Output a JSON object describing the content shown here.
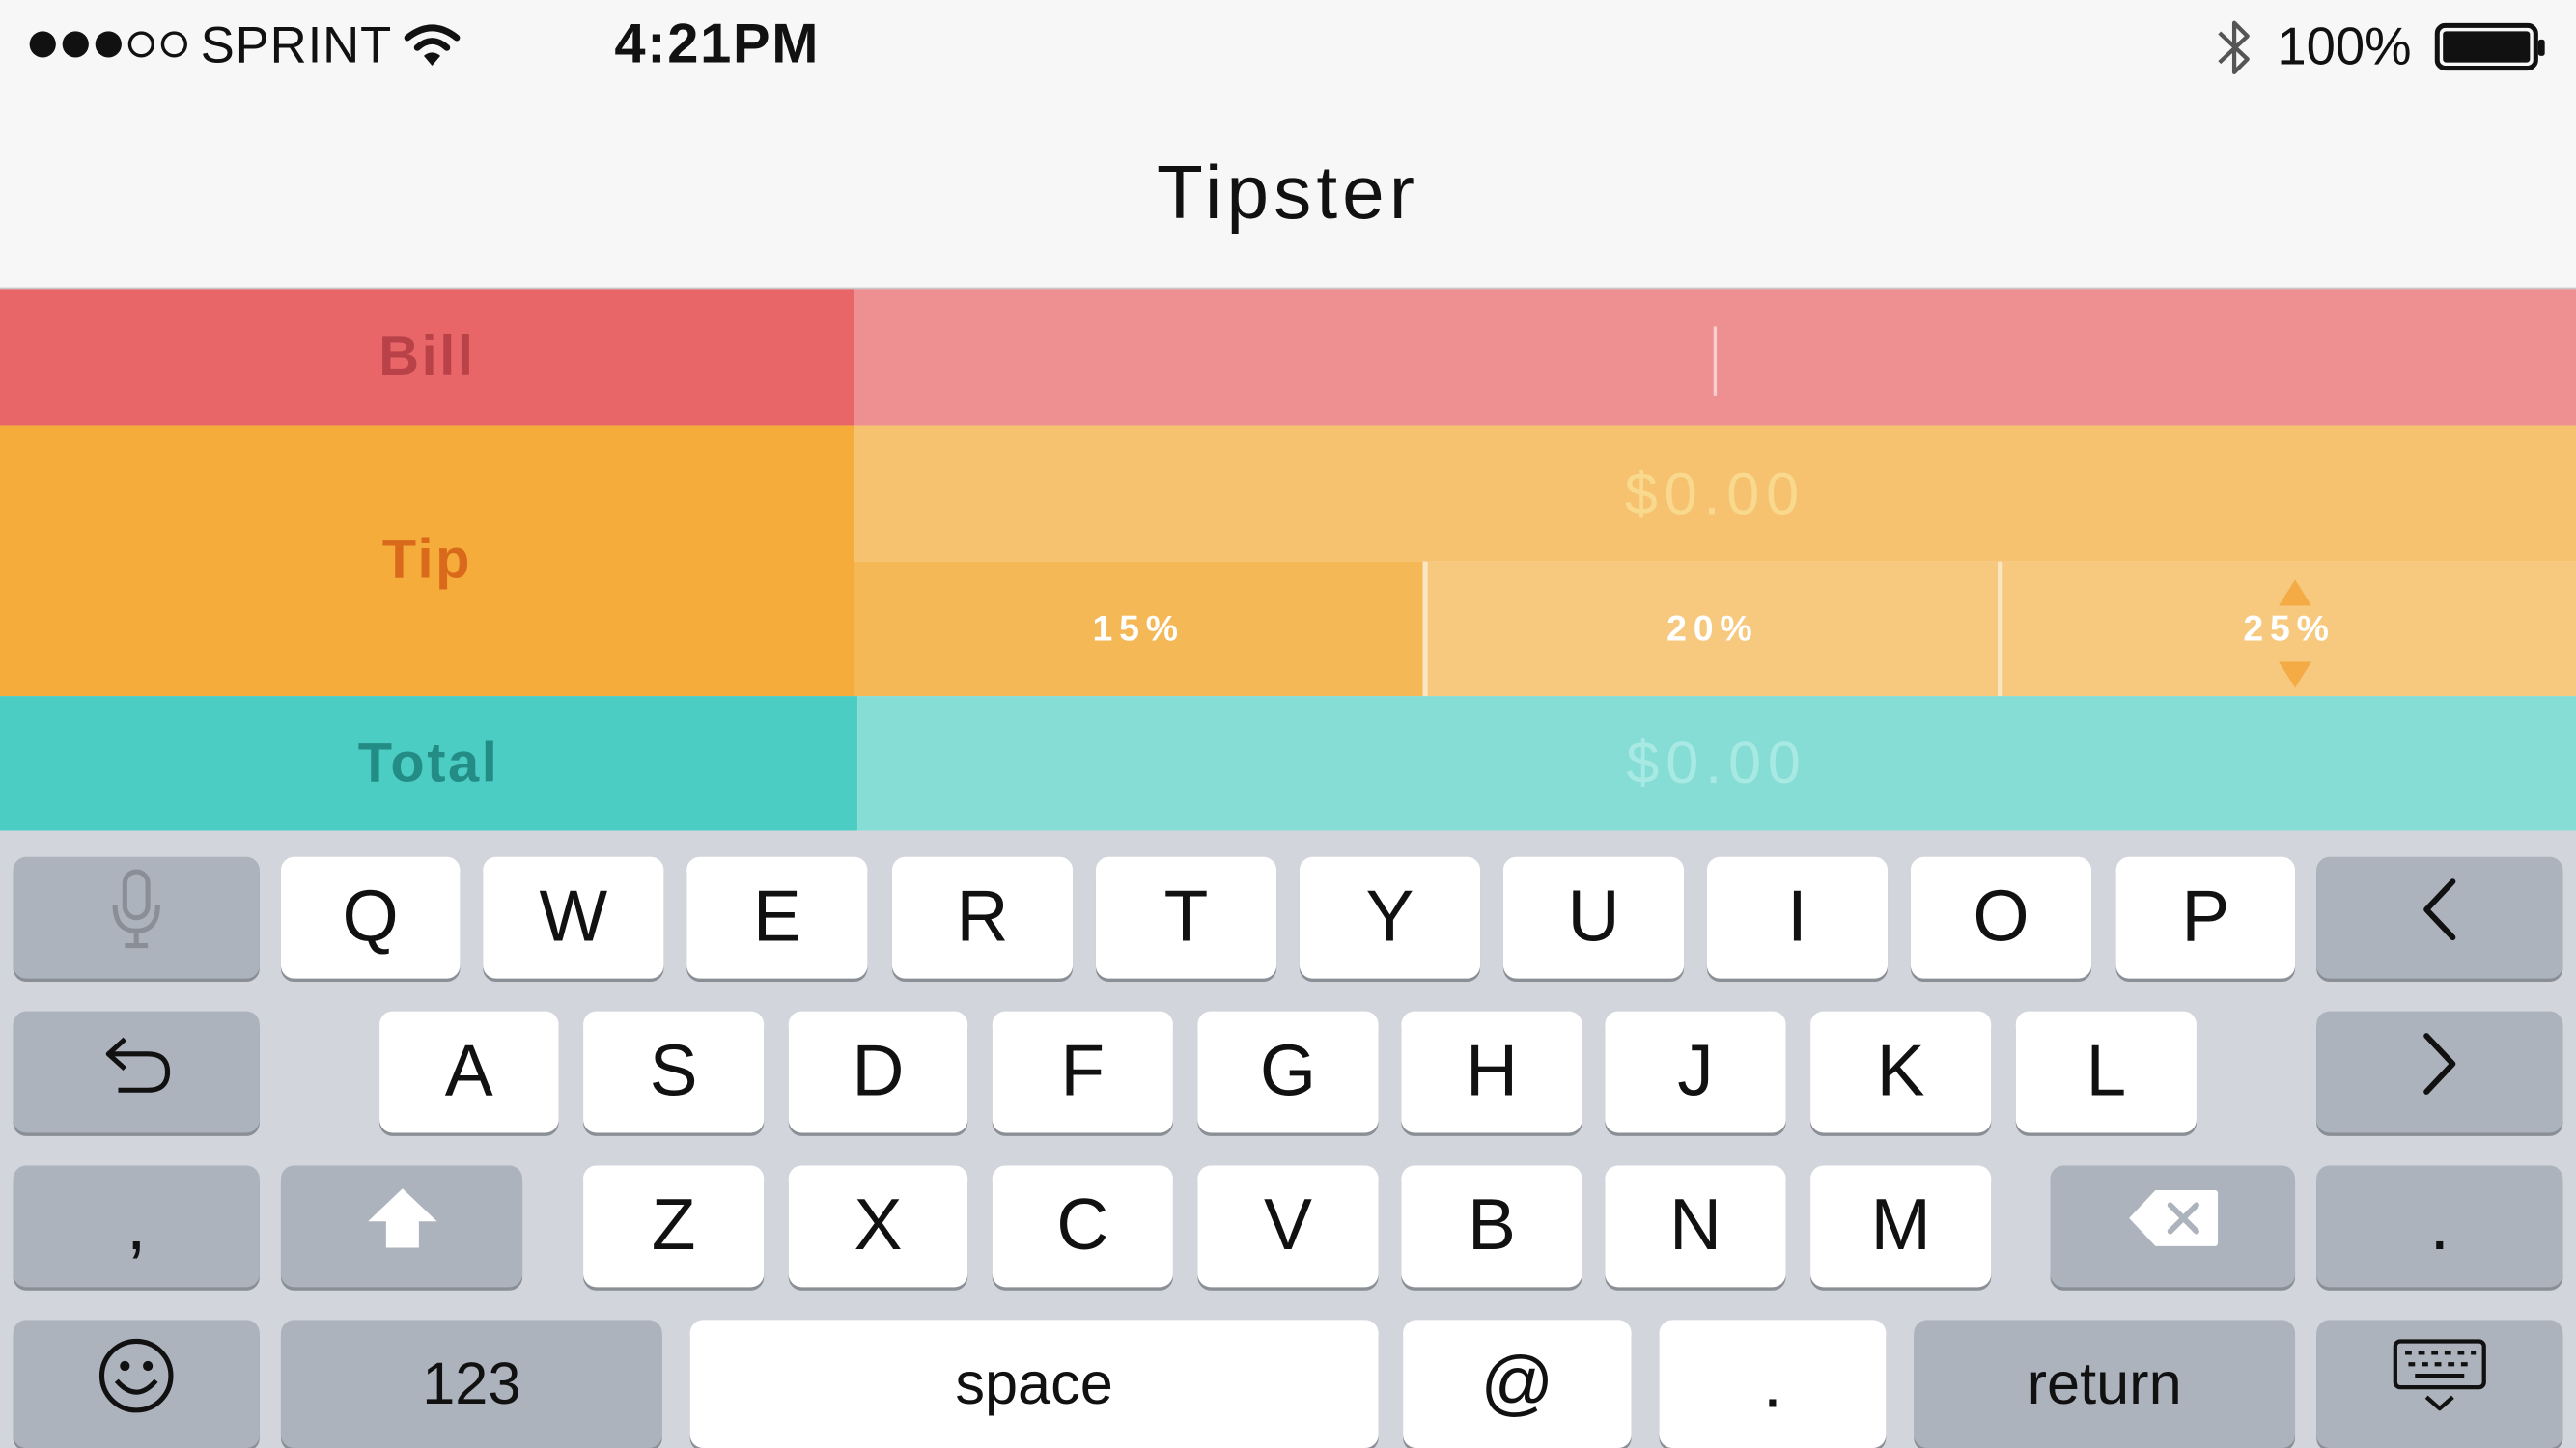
{
  "status_bar": {
    "carrier": "SPRINT",
    "signal_bars_full": 3,
    "signal_bars_total": 5,
    "time": "4:21PM",
    "battery": "100%"
  },
  "nav": {
    "title": "Tipster"
  },
  "form": {
    "bill": {
      "label": "Bill",
      "value": ""
    },
    "tip": {
      "label": "Tip",
      "amount": "$0.00",
      "options": [
        "15%",
        "20%",
        "25%"
      ],
      "selected": "15%"
    },
    "total": {
      "label": "Total",
      "amount": "$0.00"
    }
  },
  "colors": {
    "bill": "#e86668",
    "tip": "#f5ac3a",
    "total": "#4ccdc4"
  },
  "keyboard": {
    "row1": [
      "Q",
      "W",
      "E",
      "R",
      "T",
      "Y",
      "U",
      "I",
      "O",
      "P"
    ],
    "row2": [
      "A",
      "S",
      "D",
      "F",
      "G",
      "H",
      "J",
      "K",
      "L"
    ],
    "row3": [
      "Z",
      "X",
      "C",
      "V",
      "B",
      "N",
      "M"
    ],
    "comma": ",",
    "period": ".",
    "numbers": "123",
    "space": "space",
    "at": "@",
    "dot": ".",
    "return": "return",
    "icons": {
      "mic": "microphone-icon",
      "undo": "undo-icon",
      "left": "chevron-left-icon",
      "right": "chevron-right-icon",
      "shift": "shift-icon",
      "delete": "delete-icon",
      "emoji": "emoji-icon",
      "dismiss": "keyboard-dismiss-icon"
    }
  }
}
